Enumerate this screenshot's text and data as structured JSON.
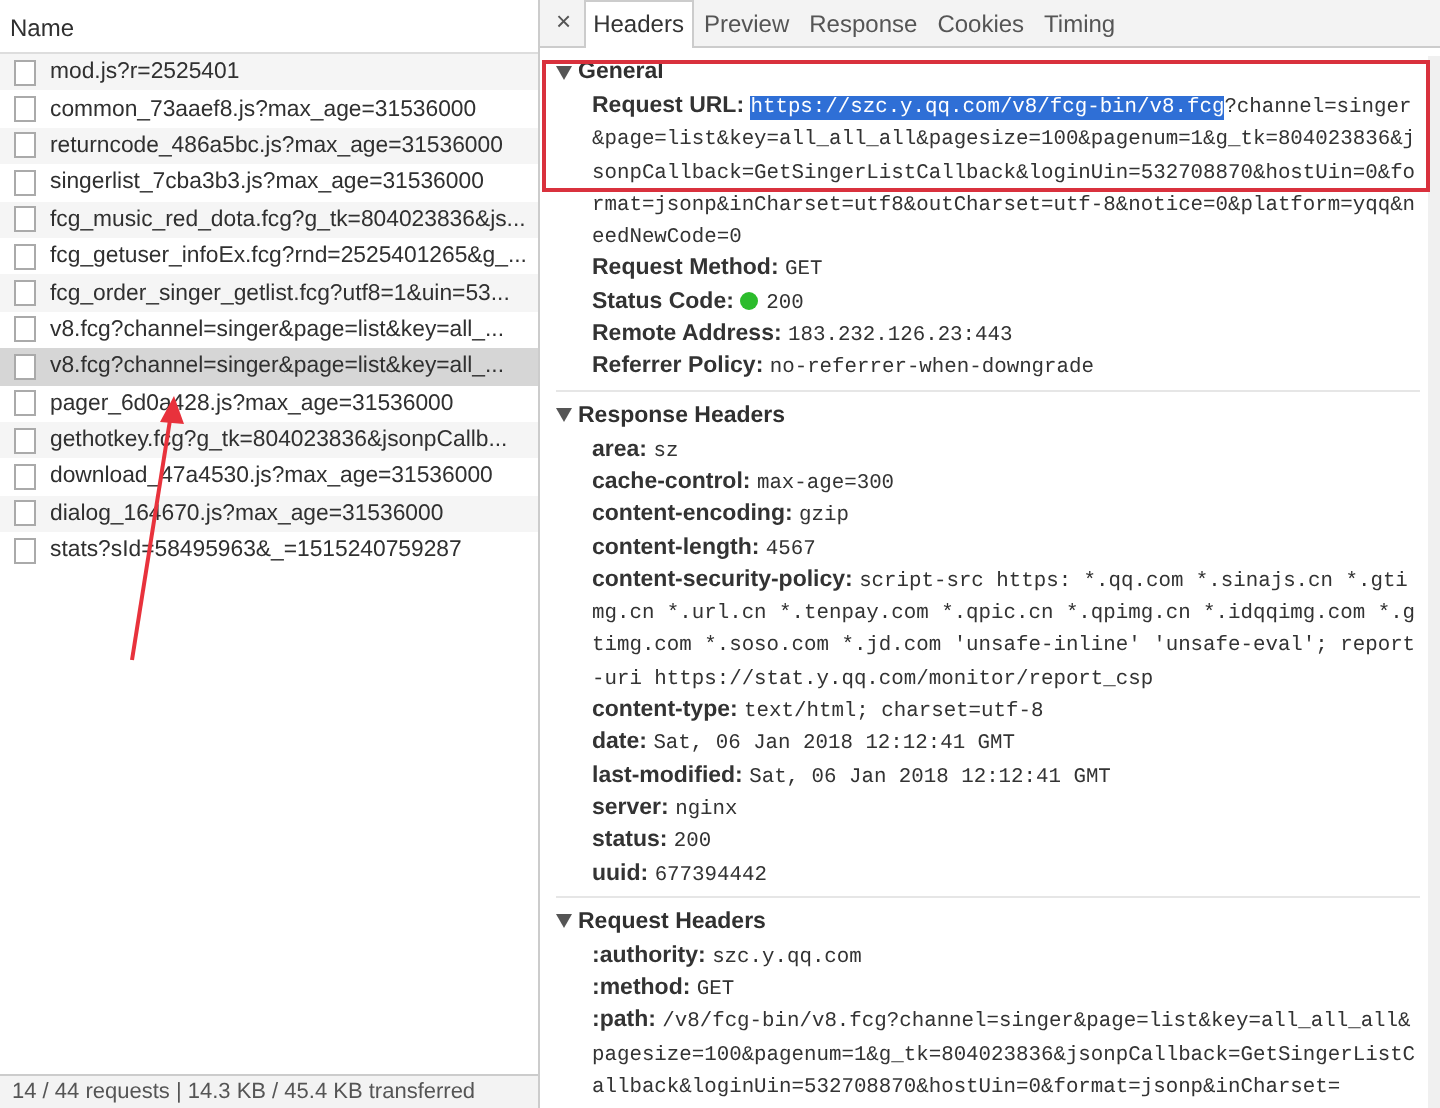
{
  "request_list": {
    "column": "Name",
    "rows": [
      {
        "name": "mod.js?r=2525401",
        "selected": false
      },
      {
        "name": "common_73aaef8.js?max_age=31536000",
        "selected": false
      },
      {
        "name": "returncode_486a5bc.js?max_age=31536000",
        "selected": false
      },
      {
        "name": "singerlist_7cba3b3.js?max_age=31536000",
        "selected": false
      },
      {
        "name": "fcg_music_red_dota.fcg?g_tk=804023836&js...",
        "selected": false
      },
      {
        "name": "fcg_getuser_infoEx.fcg?rnd=2525401265&g_...",
        "selected": false
      },
      {
        "name": "fcg_order_singer_getlist.fcg?utf8=1&uin=53...",
        "selected": false
      },
      {
        "name": "v8.fcg?channel=singer&page=list&key=all_...",
        "selected": false
      },
      {
        "name": "v8.fcg?channel=singer&page=list&key=all_...",
        "selected": true
      },
      {
        "name": "pager_6d0a428.js?max_age=31536000",
        "selected": false
      },
      {
        "name": "gethotkey.fcg?g_tk=804023836&jsonpCallb...",
        "selected": false
      },
      {
        "name": "download_47a4530.js?max_age=31536000",
        "selected": false
      },
      {
        "name": "dialog_164670.js?max_age=31536000",
        "selected": false
      },
      {
        "name": "stats?sId=58495963&_=1515240759287",
        "selected": false
      }
    ],
    "status_bar": "14 / 44 requests | 14.3 KB / 45.4 KB transferred"
  },
  "detail": {
    "close": "×",
    "tabs": [
      {
        "label": "Headers",
        "selected": true
      },
      {
        "label": "Preview",
        "selected": false
      },
      {
        "label": "Response",
        "selected": false
      },
      {
        "label": "Cookies",
        "selected": false
      },
      {
        "label": "Timing",
        "selected": false
      }
    ],
    "sections": [
      {
        "title": "General",
        "expanded": true,
        "rows": [
          {
            "key": "Request URL:",
            "selected_value": "https://szc.y.qq.com/v8/fcg-bin/v8.fcg",
            "value": "?channel=singer&page=list&key=all_all_all&pagesize=100&pagenum=1&g_tk=804023836&jsonpCallback=GetSingerListCallback&loginUin=532708870&hostUin=0&format=jsonp&inCharset=utf8&outCharset=utf-8&notice=0&platform=yqq&needNewCode=0"
          },
          {
            "key": "Request Method:",
            "value": "GET"
          },
          {
            "key": "Status Code:",
            "value": "200",
            "kind": "status",
            "color": "#2cbc2c"
          },
          {
            "key": "Remote Address:",
            "value": "183.232.126.23:443"
          },
          {
            "key": "Referrer Policy:",
            "value": "no-referrer-when-downgrade"
          }
        ]
      },
      {
        "title": "Response Headers",
        "expanded": true,
        "rows": [
          {
            "key": "area:",
            "value": "sz"
          },
          {
            "key": "cache-control:",
            "value": "max-age=300"
          },
          {
            "key": "content-encoding:",
            "value": "gzip"
          },
          {
            "key": "content-length:",
            "value": "4567"
          },
          {
            "key": "content-security-policy:",
            "value": "script-src https: *.qq.com *.sinajs.cn *.gtimg.cn *.url.cn *.tenpay.com *.qpic.cn *.qpimg.cn *.idqqimg.com *.gtimg.com *.soso.com *.jd.com 'unsafe-inline' 'unsafe-eval'; report-uri https://stat.y.qq.com/monitor/report_csp"
          },
          {
            "key": "content-type:",
            "value": "text/html; charset=utf-8"
          },
          {
            "key": "date:",
            "value": "Sat, 06 Jan 2018 12:12:41 GMT"
          },
          {
            "key": "last-modified:",
            "value": "Sat, 06 Jan 2018 12:12:41 GMT"
          },
          {
            "key": "server:",
            "value": "nginx"
          },
          {
            "key": "status:",
            "value": "200"
          },
          {
            "key": "uuid:",
            "value": "677394442"
          }
        ]
      },
      {
        "title": "Request Headers",
        "expanded": true,
        "rows": [
          {
            "key": ":authority:",
            "value": "szc.y.qq.com"
          },
          {
            "key": ":method:",
            "value": "GET"
          },
          {
            "key": ":path:",
            "value": "/v8/fcg-bin/v8.fcg?channel=singer&page=list&key=all_all_all&pagesize=100&pagenum=1&g_tk=804023836&jsonpCallback=GetSingerListCallback&loginUin=532708870&hostUin=0&format=jsonp&inCharset="
          }
        ]
      }
    ]
  }
}
